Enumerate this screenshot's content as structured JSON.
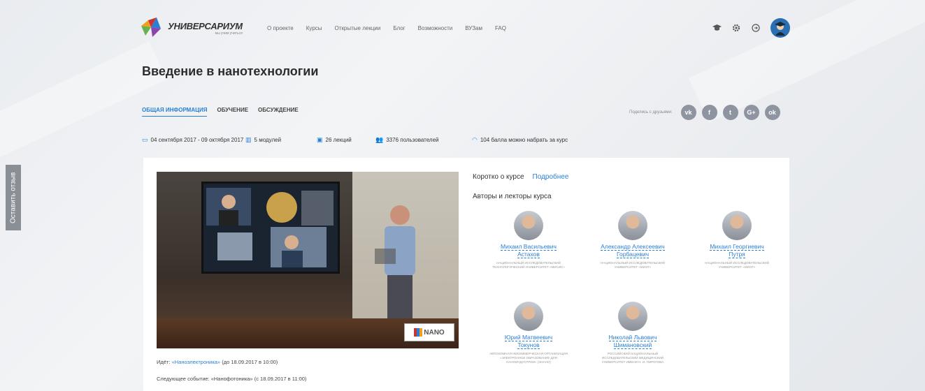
{
  "feedback_tab": "Оставить отзыв",
  "header": {
    "logo_title": "УНИВЕРСАРИУМ",
    "logo_sub": "мы учим учиться",
    "nav": [
      "О проекте",
      "Курсы",
      "Открытые лекции",
      "Блог",
      "Возможности",
      "ВУЗам",
      "FAQ"
    ],
    "icons": [
      "graduation-cap-icon",
      "gear-icon",
      "logout-icon"
    ]
  },
  "course": {
    "title": "Введение в нанотехнологии",
    "tabs": [
      "ОБЩАЯ ИНФОРМАЦИЯ",
      "ОБУЧЕНИЕ",
      "ОБСУЖДЕНИЕ"
    ],
    "share_label": "Поделись с друзьями:",
    "social": [
      "vk",
      "f",
      "t",
      "G+",
      "ok"
    ],
    "stats": {
      "dates": "04 сентября 2017 - 09 октября 2017",
      "modules": "5 модулей",
      "lectures": "26 лекций",
      "users": "3376 пользователей",
      "points": "104 балла можно набрать за курс"
    }
  },
  "card": {
    "nano_badge": "NANO",
    "live_prefix": "Идёт:",
    "live_link": "«Наноэлектроника»",
    "live_suffix": "(до 18.09.2017 в 10:00)",
    "next_text": "Следующее событие: «Нанофотоника» (с 18.09.2017 в 11:00)",
    "about_label": "Коротко о курсе",
    "about_more": "Подробнее",
    "authors_heading": "Авторы и лекторы курса",
    "authors": [
      {
        "name1": "Михаил Васильевич",
        "name2": "Астахов",
        "org": "Национальный исследовательский технологический университет «МИСиС»"
      },
      {
        "name1": "Александр Алексеевич",
        "name2": "Горбацевич",
        "org": "Национальный исследовательский университет «МИЭТ»"
      },
      {
        "name1": "Михаил Георгиевич",
        "name2": "Путря",
        "org": "Национальный исследовательский университет «МИЭТ»"
      },
      {
        "name1": "Юрий Матвеевич",
        "name2": "Токунов",
        "org": "Автономная некоммерческая организация «Электронное образование для наноиндустрии» (ЭНАНО)"
      },
      {
        "name1": "Николай Львович",
        "name2": "Шимановский",
        "org": "Российский национальный исследовательский медицинский университет имени Н. И. Пирогова"
      }
    ]
  }
}
